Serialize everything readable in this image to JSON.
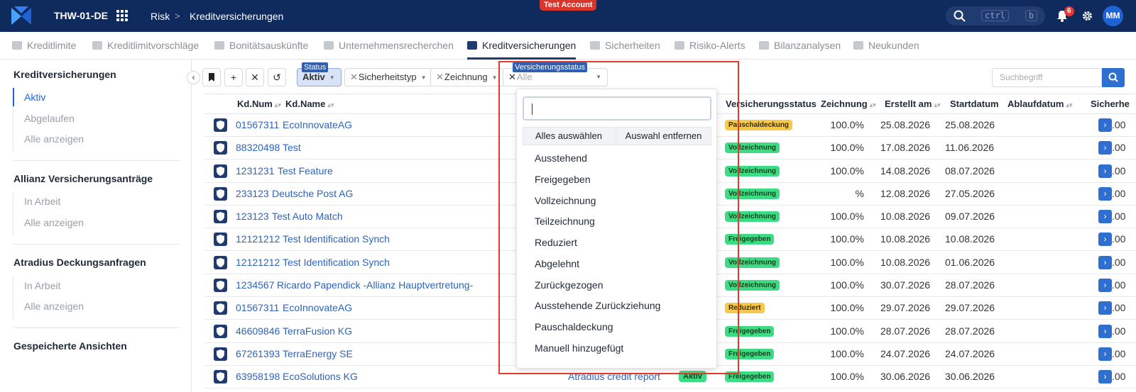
{
  "topbar": {
    "tenant": "THW-01-DE",
    "breadcrumb": [
      "Risk",
      "Kreditversicherungen"
    ],
    "test_badge": "Test Account",
    "kbd": [
      "ctrl",
      "b"
    ],
    "notification_count": "6",
    "avatar": "MM"
  },
  "tabs": [
    "Kreditlimite",
    "Kreditlimitvorschläge",
    "Bonitätsauskünfte",
    "Unternehmensrecherchen",
    "Kreditversicherungen",
    "Sicherheiten",
    "Risiko-Alerts",
    "Bilanzanalysen",
    "Neukunden"
  ],
  "active_tab": "Kreditversicherungen",
  "sidebar": {
    "sections": [
      {
        "title": "Kreditversicherungen",
        "items": [
          "Aktiv",
          "Abgelaufen",
          "Alle anzeigen"
        ]
      },
      {
        "title": "Allianz Versicherungsanträge",
        "items": [
          "In Arbeit",
          "Alle anzeigen"
        ]
      },
      {
        "title": "Atradius Deckungsanfragen",
        "items": [
          "In Arbeit",
          "Alle anzeigen"
        ]
      },
      {
        "title": "Gespeicherte Ansichten",
        "items": []
      }
    ]
  },
  "filters": {
    "status_label": "Status",
    "status_value": "Aktiv",
    "sicherheitstyp": "Sicherheitstyp",
    "zeichnung": "Zeichnung",
    "vs_label": "Versicherungsstatus",
    "vs_value": "Alle",
    "search_placeholder": "Suchbegriff"
  },
  "columns": {
    "kdnum": "Kd.Num",
    "kdname": "Kd.Name",
    "vs": "Versicherungsstatus",
    "zeichnung": "Zeichnung",
    "erstellt": "Erstellt am",
    "start": "Startdatum",
    "ablauf": "Ablaufdatum",
    "sicher": "Sicherhe"
  },
  "rows": [
    {
      "num": "01567311",
      "name": "EcoInnovateAG",
      "vs": "Pauschaldeckung",
      "vs_color": "yellow",
      "z": "100.0%",
      "e": "25.08.2026",
      "s": "25.08.2026"
    },
    {
      "num": "88320498",
      "name": "Test",
      "vs": "Vollzeichnung",
      "vs_color": "green",
      "z": "100.0%",
      "e": "17.08.2026",
      "s": "11.06.2026"
    },
    {
      "num": "1231231",
      "name": "Test Feature",
      "vs": "Vollzeichnung",
      "vs_color": "green",
      "z": "100.0%",
      "e": "14.08.2026",
      "s": "08.07.2026"
    },
    {
      "num": "233123",
      "name": "Deutsche Post AG",
      "vs": "Vollzeichnung",
      "vs_color": "green",
      "z": "%",
      "e": "12.08.2026",
      "s": "27.05.2026"
    },
    {
      "num": "123123",
      "name": "Test Auto Match",
      "vs": "Vollzeichnung",
      "vs_color": "green",
      "z": "100.0%",
      "e": "10.08.2026",
      "s": "09.07.2026"
    },
    {
      "num": "12121212",
      "name": "Test Identification Synch",
      "vs": "Freigegeben",
      "vs_color": "green",
      "z": "100.0%",
      "e": "10.08.2026",
      "s": "10.08.2026"
    },
    {
      "num": "12121212",
      "name": "Test Identification Synch",
      "vs": "Vollzeichnung",
      "vs_color": "green",
      "z": "100.0%",
      "e": "10.08.2026",
      "s": "01.06.2026"
    },
    {
      "num": "1234567",
      "name": "Ricardo Papendick -Allianz Hauptvertretung-",
      "vs": "Vollzeichnung",
      "vs_color": "green",
      "z": "100.0%",
      "e": "30.07.2026",
      "s": "28.07.2026"
    },
    {
      "num": "01567311",
      "name": "EcoInnovateAG",
      "vs": "Reduziert",
      "vs_color": "yellow",
      "z": "100.0%",
      "e": "29.07.2026",
      "s": "29.07.2026"
    },
    {
      "num": "46609846",
      "name": "TerraFusion KG",
      "vs": "Freigegeben",
      "vs_color": "green",
      "z": "100.0%",
      "e": "28.07.2026",
      "s": "28.07.2026"
    },
    {
      "num": "67261393",
      "name": "TerraEnergy SE",
      "vs": "Freigegeben",
      "vs_color": "green",
      "z": "100.0%",
      "e": "24.07.2026",
      "s": "24.07.2026"
    },
    {
      "num": "63958198",
      "name": "EcoSolutions KG",
      "vs": "Freigegeben",
      "vs_color": "green",
      "z": "100.0%",
      "e": "30.06.2026",
      "s": "30.06.2026",
      "source": "Atradius credit report",
      "active": "Aktiv"
    }
  ],
  "trunc_text": ".00",
  "dropdown": {
    "select_all": "Alles auswählen",
    "clear": "Auswahl entfernen",
    "options": [
      "Ausstehend",
      "Freigegeben",
      "Vollzeichnung",
      "Teilzeichnung",
      "Reduziert",
      "Abgelehnt",
      "Zurückgezogen",
      "Ausstehende Zurückziehung",
      "Pauschaldeckung",
      "Manuell hinzugefügt"
    ]
  },
  "colors": {
    "navy": "#0f2a5c",
    "accent": "#1e63d6",
    "highlight": "#e03a2c",
    "green": "#3ddc84",
    "yellow": "#f7c948"
  }
}
